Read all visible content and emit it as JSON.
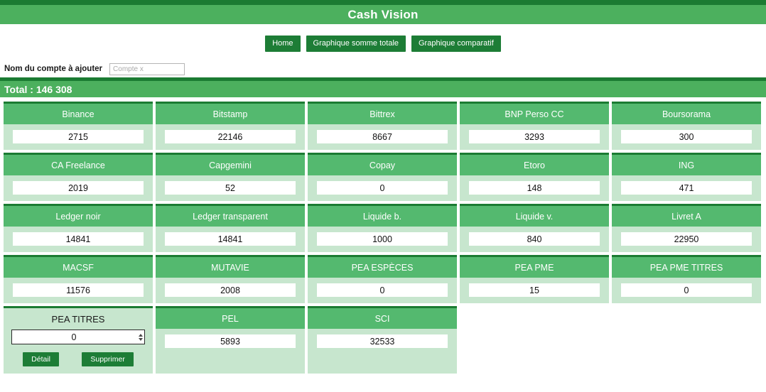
{
  "header": {
    "app_title": "Cash Vision"
  },
  "nav": {
    "items": [
      {
        "label": "Home",
        "name": "nav-home"
      },
      {
        "label": "Graphique somme totale",
        "name": "nav-graphique-somme-totale"
      },
      {
        "label": "Graphique comparatif",
        "name": "nav-graphique-comparatif"
      }
    ]
  },
  "add_account": {
    "label": "Nom du compte à ajouter",
    "placeholder": "Compte x",
    "value": ""
  },
  "total": {
    "text": "Total : 146 308",
    "label": "Total :",
    "value": "146 308"
  },
  "card_actions": {
    "detail_label": "Détail",
    "delete_label": "Supprimer"
  },
  "colors": {
    "dark_green": "#1b7b32",
    "title_green": "#4cb05e",
    "header_green": "#54b96f",
    "body_green": "#c7e6ce",
    "button_green": "#1d7d36",
    "white": "#ffffff"
  },
  "accounts": [
    [
      {
        "name": "Binance",
        "value": "2715"
      },
      {
        "name": "Bitstamp",
        "value": "22146"
      },
      {
        "name": "Bittrex",
        "value": "8667"
      },
      {
        "name": "BNP Perso CC",
        "value": "3293"
      },
      {
        "name": "Boursorama",
        "value": "300"
      }
    ],
    [
      {
        "name": "CA Freelance",
        "value": "2019"
      },
      {
        "name": "Capgemini",
        "value": "52"
      },
      {
        "name": "Copay",
        "value": "0"
      },
      {
        "name": "Etoro",
        "value": "148"
      },
      {
        "name": "ING",
        "value": "471"
      }
    ],
    [
      {
        "name": "Ledger noir",
        "value": "14841"
      },
      {
        "name": "Ledger transparent",
        "value": "14841"
      },
      {
        "name": "Liquide b.",
        "value": "1000"
      },
      {
        "name": "Liquide v.",
        "value": "840"
      },
      {
        "name": "Livret A",
        "value": "22950"
      }
    ],
    [
      {
        "name": "MACSF",
        "value": "11576"
      },
      {
        "name": "MUTAVIE",
        "value": "2008"
      },
      {
        "name": "PEA ESPÈCES",
        "value": "0"
      },
      {
        "name": "PEA PME",
        "value": "15"
      },
      {
        "name": "PEA PME TITRES",
        "value": "0"
      }
    ],
    [
      {
        "name": "PEA TITRES",
        "value": "0",
        "active": true
      },
      {
        "name": "PEL",
        "value": "5893"
      },
      {
        "name": "SCI",
        "value": "32533"
      }
    ]
  ]
}
